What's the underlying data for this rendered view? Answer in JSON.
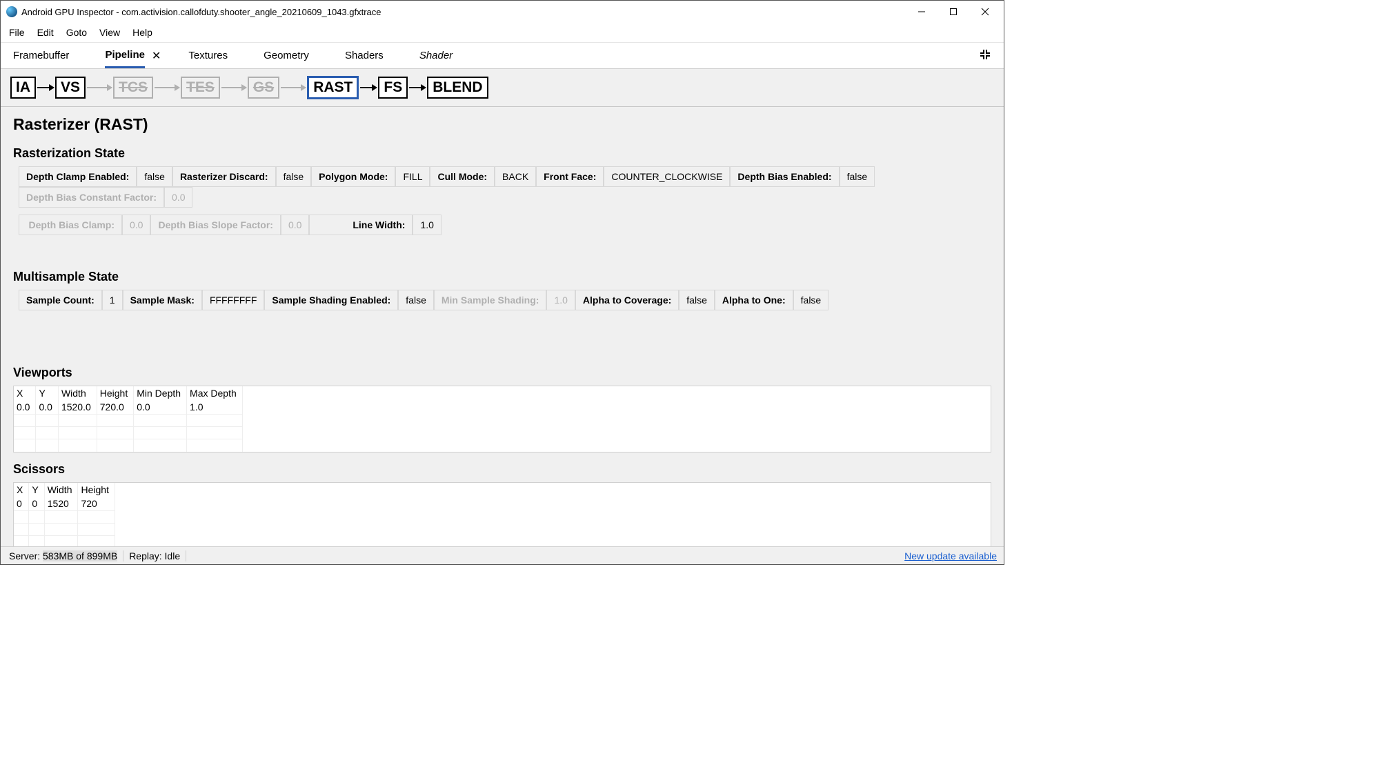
{
  "window": {
    "title": "Android GPU Inspector - com.activision.callofduty.shooter_angle_20210609_1043.gfxtrace"
  },
  "menu": {
    "items": [
      "File",
      "Edit",
      "Goto",
      "View",
      "Help"
    ]
  },
  "tabs": {
    "items": [
      "Framebuffer",
      "Pipeline",
      "Textures",
      "Geometry",
      "Shaders",
      "Shader"
    ],
    "active": "Pipeline"
  },
  "pipeline": {
    "stages": [
      {
        "label": "IA",
        "disabled": false,
        "selected": false
      },
      {
        "label": "VS",
        "disabled": false,
        "selected": false
      },
      {
        "label": "TCS",
        "disabled": true,
        "selected": false
      },
      {
        "label": "TES",
        "disabled": true,
        "selected": false
      },
      {
        "label": "GS",
        "disabled": true,
        "selected": false
      },
      {
        "label": "RAST",
        "disabled": false,
        "selected": true
      },
      {
        "label": "FS",
        "disabled": false,
        "selected": false
      },
      {
        "label": "BLEND",
        "disabled": false,
        "selected": false
      }
    ]
  },
  "page": {
    "title": "Rasterizer (RAST)",
    "rasterization_heading": "Rasterization State",
    "rasterization_row1": [
      {
        "label": "Depth Clamp Enabled:",
        "value": "false",
        "disabled": false
      },
      {
        "label": "Rasterizer Discard:",
        "value": "false",
        "disabled": false
      },
      {
        "label": "Polygon Mode:",
        "value": "FILL",
        "disabled": false
      },
      {
        "label": "Cull Mode:",
        "value": "BACK",
        "disabled": false
      },
      {
        "label": "Front Face:",
        "value": "COUNTER_CLOCKWISE",
        "disabled": false
      },
      {
        "label": "Depth Bias Enabled:",
        "value": "false",
        "disabled": false
      },
      {
        "label": "Depth Bias Constant Factor:",
        "value": "0.0",
        "disabled": true
      }
    ],
    "rasterization_row2": [
      {
        "label": "Depth Bias Clamp:",
        "value": "0.0",
        "disabled": true
      },
      {
        "label": "Depth Bias Slope Factor:",
        "value": "0.0",
        "disabled": true
      },
      {
        "label": "Line Width:",
        "value": "1.0",
        "disabled": false
      }
    ],
    "multisample_heading": "Multisample State",
    "multisample_row": [
      {
        "label": "Sample Count:",
        "value": "1",
        "disabled": false
      },
      {
        "label": "Sample Mask:",
        "value": "FFFFFFFF",
        "disabled": false
      },
      {
        "label": "Sample Shading Enabled:",
        "value": "false",
        "disabled": false
      },
      {
        "label": "Min Sample Shading:",
        "value": "1.0",
        "disabled": true
      },
      {
        "label": "Alpha to Coverage:",
        "value": "false",
        "disabled": false
      },
      {
        "label": "Alpha to One:",
        "value": "false",
        "disabled": false
      }
    ],
    "viewports_heading": "Viewports",
    "viewports": {
      "headers": [
        "X",
        "Y",
        "Width",
        "Height",
        "Min Depth",
        "Max Depth"
      ],
      "rows": [
        [
          "0.0",
          "0.0",
          "1520.0",
          "720.0",
          "0.0",
          "1.0"
        ]
      ]
    },
    "scissors_heading": "Scissors",
    "scissors": {
      "headers": [
        "X",
        "Y",
        "Width",
        "Height"
      ],
      "rows": [
        [
          "0",
          "0",
          "1520",
          "720"
        ]
      ]
    }
  },
  "status": {
    "server_label": "Server:",
    "server_value": "583MB of 899MB",
    "replay_label": "Replay:",
    "replay_value": "Idle",
    "update_link": "New update available"
  }
}
